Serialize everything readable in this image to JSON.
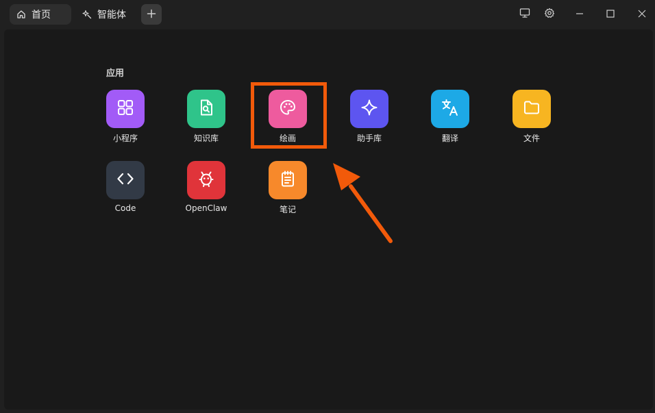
{
  "tabs": [
    {
      "label": "首页",
      "icon": "home-icon",
      "active": true
    },
    {
      "label": "智能体",
      "icon": "sparkle-agent-icon",
      "active": false
    }
  ],
  "titlebar_buttons": [
    "monitor-icon",
    "gear-icon",
    "minimize-icon",
    "maximize-icon",
    "close-icon"
  ],
  "section": {
    "title": "应用"
  },
  "apps": [
    {
      "label": "小程序",
      "icon": "grid-icon",
      "color": "#a25bf7"
    },
    {
      "label": "知识库",
      "icon": "document-search-icon",
      "color": "#2fc48a"
    },
    {
      "label": "绘画",
      "icon": "palette-icon",
      "color": "#ee5b9e"
    },
    {
      "label": "助手库",
      "icon": "sparkle-icon",
      "color": "#5d55f0"
    },
    {
      "label": "翻译",
      "icon": "translate-icon",
      "color": "#1da9e6"
    },
    {
      "label": "文件",
      "icon": "folder-icon",
      "color": "#f7b521"
    },
    {
      "label": "Code",
      "icon": "code-icon",
      "color": "#323a46"
    },
    {
      "label": "OpenClaw",
      "icon": "lobster-icon",
      "color": "#e0343a"
    },
    {
      "label": "笔记",
      "icon": "notepad-icon",
      "color": "#f7892b"
    }
  ],
  "annotation": {
    "highlight_color": "#f25a0a",
    "target": "绘画"
  }
}
